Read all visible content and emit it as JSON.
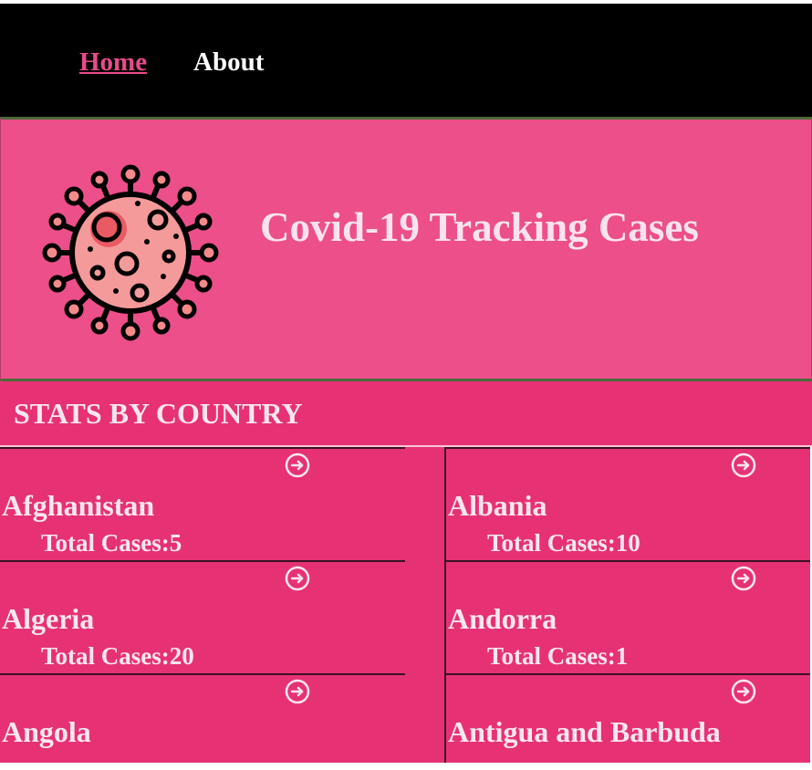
{
  "nav": {
    "items": [
      {
        "label": "Home",
        "active": true
      },
      {
        "label": "About",
        "active": false
      }
    ]
  },
  "hero": {
    "title": "Covid-19 Tracking Cases",
    "logo_icon": "virus-icon"
  },
  "stats": {
    "title": "STATS BY COUNTRY",
    "total_label": "Total Cases:",
    "countries": [
      {
        "name": "Afghanistan",
        "total_text": "Total Cases:5"
      },
      {
        "name": "Albania",
        "total_text": "Total Cases:10"
      },
      {
        "name": "Algeria",
        "total_text": "Total Cases:20"
      },
      {
        "name": "Andorra",
        "total_text": "Total Cases:1"
      },
      {
        "name": "Angola",
        "total_text": ""
      },
      {
        "name": "Antigua and Barbuda",
        "total_text": ""
      }
    ],
    "card_icon": "arrow-right-circle-icon"
  },
  "colors": {
    "navbar": "#000000",
    "active_link": "#e84b8a",
    "hero_bg": "#ec4f8a",
    "card_bg": "#e63275",
    "text_light": "#fde7ef"
  }
}
